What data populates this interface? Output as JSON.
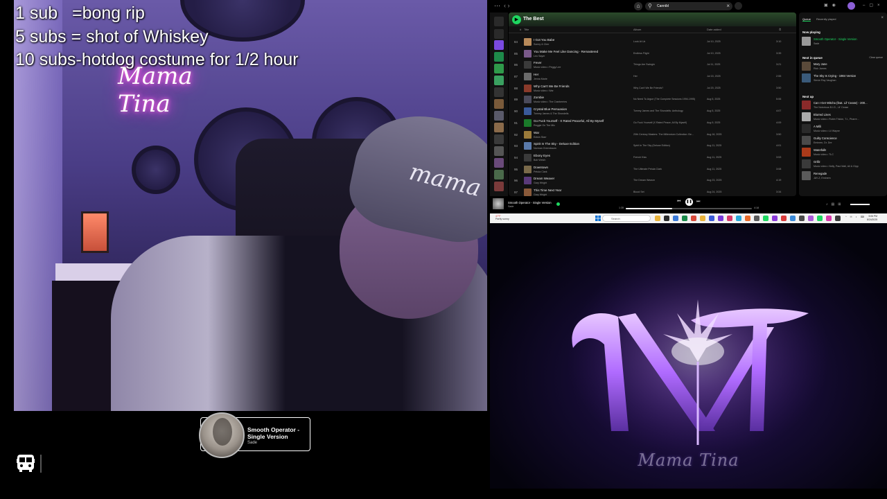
{
  "overlay": {
    "sub_lines": [
      "1 sub   =bong rip",
      "5 subs = shot of Whiskey",
      "10 subs-hotdog costume for 1/2 hour"
    ],
    "neon_sign": "Mama Tina",
    "cap_text": "mama"
  },
  "now_playing_widget": {
    "title": "Smooth Operator - Single Version",
    "artist": "Sade"
  },
  "spotify": {
    "search_value": "Cannibl",
    "playlist_title": "The Best",
    "columns": {
      "num": "#",
      "title": "Title",
      "album": "Album",
      "date": "Date added",
      "duration": "⏱"
    },
    "tracks": [
      {
        "num": "84",
        "title": "I Got You Babe",
        "artist": "Sonny & Cher",
        "album": "Look At Us",
        "date": "Jul 10, 2025",
        "duration": "3:10",
        "color": "#b88a5a"
      },
      {
        "num": "85",
        "title": "You Make Me Feel Like Dancing - Remastered",
        "artist": "Leo Sayer",
        "album": "Endless Flight",
        "date": "Jul 10, 2025",
        "duration": "3:39",
        "color": "#7a5a8a"
      },
      {
        "num": "86",
        "title": "Fever",
        "artist": "Music video • Peggy Lee",
        "album": "Things Are Swingin'",
        "date": "Jul 11, 2025",
        "duration": "3:21",
        "color": "#3a3a3a"
      },
      {
        "num": "87",
        "title": "Her",
        "artist": "Jenna Marie",
        "album": "Her",
        "date": "Jul 15, 2025",
        "duration": "2:55",
        "color": "#6a6a6a"
      },
      {
        "num": "88",
        "title": "Why Can't We Be Friends",
        "artist": "Music video • War",
        "album": "Why Can't We Be Friends?",
        "date": "Jul 20, 2025",
        "duration": "3:50",
        "color": "#8a3a2a"
      },
      {
        "num": "89",
        "title": "Zombie",
        "artist": "Music video • The Cranberries",
        "album": "No Need To Argue (The Complete Sessions 1994-1995)",
        "date": "Aug 5, 2025",
        "duration": "5:06",
        "color": "#4a4a5a"
      },
      {
        "num": "90",
        "title": "Crystal Blue Persuasion",
        "artist": "Tommy James & The Shondells",
        "album": "Tommy James and The Shondells: Anthology",
        "date": "Aug 5, 2025",
        "duration": "4:07",
        "color": "#3a5a9a"
      },
      {
        "num": "91",
        "title": "Go Fuck Yourself - X Rated Peaceful, All By Myself",
        "artist": "Reggie On The Mic",
        "album": "Go Fuck Yourself (X Rated Peace, All By Myself)",
        "date": "Aug 9, 2025",
        "duration": "4:09",
        "color": "#1a7a2a"
      },
      {
        "num": "92",
        "title": "War",
        "artist": "Edwin Starr",
        "album": "20th Century Masters: The Millennium Collection: Be...",
        "date": "Aug 16, 2025",
        "duration": "3:50",
        "color": "#9a7a3a"
      },
      {
        "num": "93",
        "title": "Spirit In The Sky - Deluxe Edition",
        "artist": "Norman Greenbaum",
        "album": "Spirit In The Sky (Deluxe Edition)",
        "date": "Aug 11, 2025",
        "duration": "4:01",
        "color": "#5a7aaa"
      },
      {
        "num": "94",
        "title": "Ebony Eyes",
        "artist": "Bob Welch",
        "album": "French Kiss",
        "date": "Aug 11, 2025",
        "duration": "3:53",
        "color": "#3a3a3a"
      },
      {
        "num": "95",
        "title": "Downtown",
        "artist": "Petula Clark",
        "album": "The Ultimate Petula Clark",
        "date": "Aug 11, 2025",
        "duration": "3:08",
        "color": "#7a6a4a"
      },
      {
        "num": "96",
        "title": "Dream Weaver",
        "artist": "Gary Wright",
        "album": "The Dream Weaver",
        "date": "Aug 23, 2025",
        "duration": "4:19",
        "color": "#5a3a7a"
      },
      {
        "num": "97",
        "title": "This Time Next Year",
        "artist": "Gary Wright",
        "album": "Blood Set",
        "date": "Aug 24, 2025",
        "duration": "3:34",
        "color": "#8a5a3a"
      }
    ],
    "queue": {
      "tab_active": "Queue",
      "tab_inactive": "Recently played",
      "now_playing_heading": "Now playing",
      "now_playing": {
        "title": "Smooth Operator - Single Version",
        "artist": "Sade",
        "color": "#9a9a9a"
      },
      "next_in_queue_heading": "Next in queue",
      "clear_label": "Clear queue",
      "next_in_queue": [
        {
          "title": "Mary Jane",
          "artist": "Rick James",
          "color": "#5a4a3a"
        },
        {
          "title": "The Sky Is Crying - 1984 Version",
          "artist": "Stevie Ray Vaughan",
          "color": "#3a5a7a"
        }
      ],
      "next_up_heading": "Next up",
      "next_up": [
        {
          "title": "Can I Get Witcha (feat. Lil' Cease) - 200...",
          "artist": "The Notorious B.I.G., Lil' Cease",
          "color": "#8a2a2a"
        },
        {
          "title": "Blurred Lines",
          "artist": "Music video • Robin Thicke, T.I., Pharre...",
          "color": "#aaaaaa"
        },
        {
          "title": "A Milli",
          "artist": "Music video • Lil Wayne",
          "color": "#2a2a2a"
        },
        {
          "title": "Guilty Conscience",
          "artist": "Eminem, Dr. Dre",
          "color": "#4a4a4a"
        },
        {
          "title": "Waterfalls",
          "artist": "Music video • TLC",
          "color": "#aa3a1a"
        },
        {
          "title": "Grillz",
          "artist": "Music video • Nelly, Paul Wall, Ali & Gipp",
          "color": "#3a3a3a"
        },
        {
          "title": "Renegade",
          "artist": "JAY-Z, Eminem",
          "color": "#5a5a5a"
        }
      ]
    },
    "player": {
      "title": "Smooth Operator - Single Version",
      "artist": "Sade",
      "elapsed": "1:35",
      "total": "4:18",
      "progress": 0.37
    }
  },
  "taskbar": {
    "weather_temp": "47°F",
    "weather_desc": "Partly sunny",
    "search_placeholder": "Search",
    "clock_time": "5:06 PM",
    "clock_date": "8/24/2025"
  },
  "logo": {
    "caption": "Mama Tina",
    "accent_color": "#b06bff"
  }
}
